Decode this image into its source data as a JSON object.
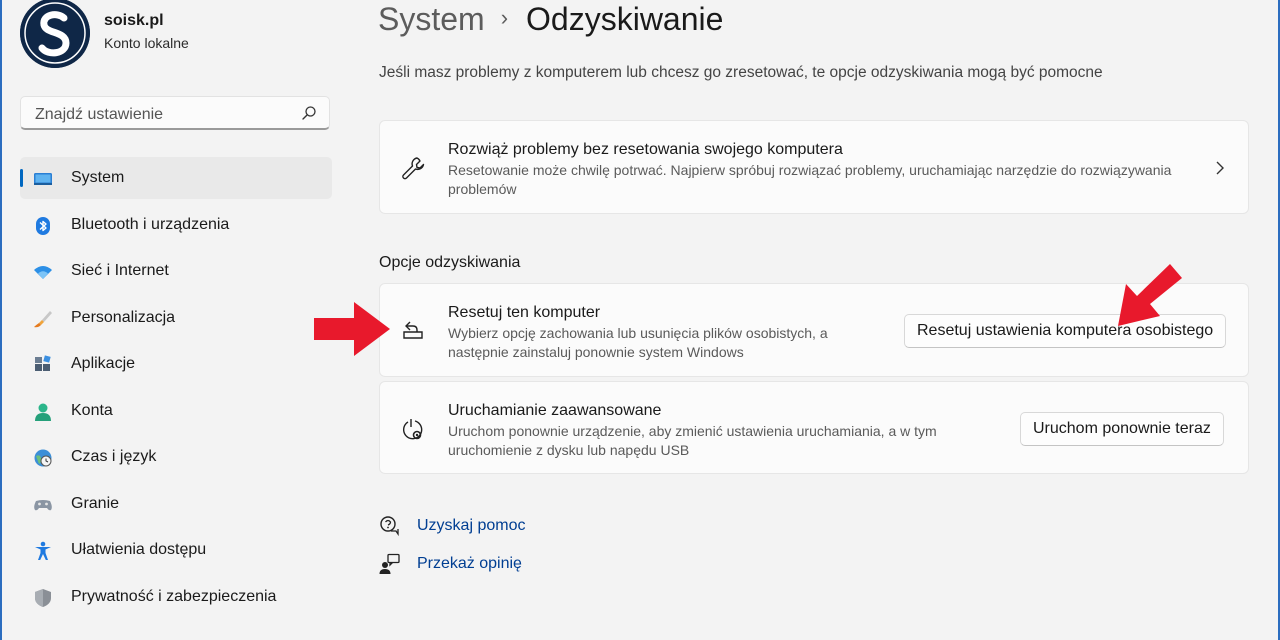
{
  "user": {
    "name": "soisk.pl",
    "account_type": "Konto lokalne"
  },
  "search": {
    "placeholder": "Znajdź ustawienie",
    "icon": "search-icon"
  },
  "sidebar": {
    "items": [
      {
        "label": "System",
        "icon": "system-monitor-icon",
        "active": true
      },
      {
        "label": "Bluetooth i urządzenia",
        "icon": "bluetooth-icon"
      },
      {
        "label": "Sieć i Internet",
        "icon": "wifi-icon"
      },
      {
        "label": "Personalizacja",
        "icon": "brush-icon"
      },
      {
        "label": "Aplikacje",
        "icon": "apps-icon"
      },
      {
        "label": "Konta",
        "icon": "person-icon"
      },
      {
        "label": "Czas i język",
        "icon": "globe-clock-icon"
      },
      {
        "label": "Granie",
        "icon": "gamepad-icon"
      },
      {
        "label": "Ułatwienia dostępu",
        "icon": "accessibility-icon"
      },
      {
        "label": "Prywatność i zabezpieczenia",
        "icon": "shield-icon"
      }
    ]
  },
  "breadcrumb": {
    "parent": "System",
    "separator": "›",
    "current": "Odzyskiwanie"
  },
  "intro": "Jeśli masz problemy z komputerem lub chcesz go zresetować, te opcje odzyskiwania mogą być pomocne",
  "troubleshoot_card": {
    "title": "Rozwiąż problemy bez resetowania swojego komputera",
    "description_line1": "Resetowanie może chwilę potrwać. Najpierw spróbuj rozwiązać problemy, uruchamiając narzędzie do rozwiązywania",
    "description_line2": "problemów",
    "icon": "wrench-icon"
  },
  "recovery_section": {
    "title": "Opcje odzyskiwania",
    "reset": {
      "title": "Resetuj ten komputer",
      "description_line1": "Wybierz opcję zachowania lub usunięcia plików osobistych, a",
      "description_line2": "następnie zainstaluj ponownie system Windows",
      "button": "Resetuj ustawienia komputera osobistego",
      "icon": "reset-pc-icon"
    },
    "advanced": {
      "title": "Uruchamianie zaawansowane",
      "description_line1": "Uruchom ponownie urządzenie, aby zmienić ustawienia uruchamiania, a w tym",
      "description_line2": "uruchomienie z dysku lub napędu USB",
      "button": "Uruchom ponownie teraz",
      "icon": "advanced-startup-icon"
    }
  },
  "links": {
    "help": {
      "label": "Uzyskaj pomoc",
      "icon": "help-icon"
    },
    "feedback": {
      "label": "Przekaż opinię",
      "icon": "feedback-icon"
    }
  },
  "colors": {
    "accent": "#0067c0",
    "annotation_arrow": "#e8192c",
    "link": "#003e92"
  }
}
